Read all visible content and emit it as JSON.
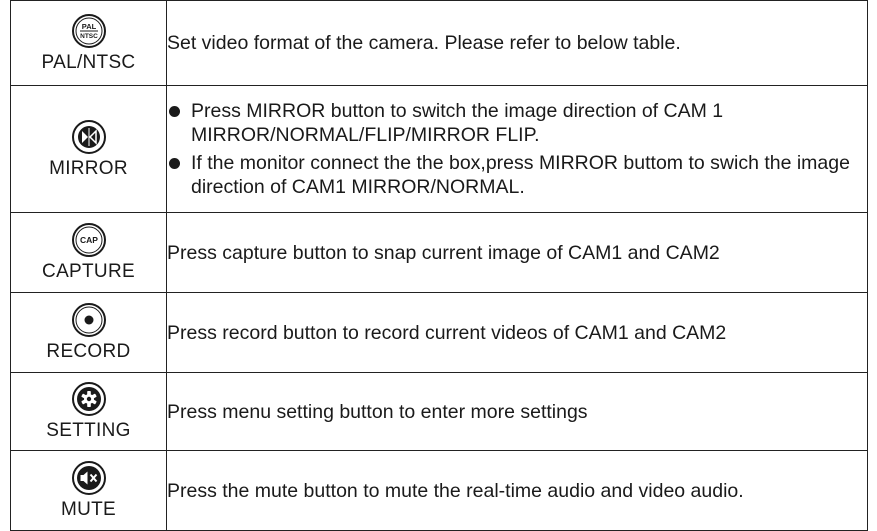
{
  "rows": [
    {
      "icon": "pal-ntsc-icon",
      "icon_text": [
        "PAL",
        "NTSC"
      ],
      "label": "PAL/NTSC",
      "description": "Set video format of the camera. Please refer to below table."
    },
    {
      "icon": "mirror-icon",
      "label": "MIRROR",
      "bullets": [
        "Press MIRROR button to switch the image direction of CAM 1 MIRROR/NORMAL/FLIP/MIRROR FLIP.",
        "If the monitor connect the the box,press MIRROR buttom to swich the image direction of CAM1  MIRROR/NORMAL."
      ]
    },
    {
      "icon": "capture-icon",
      "icon_text": "CAP",
      "label": "CAPTURE",
      "description": "Press capture button to snap current image of CAM1 and CAM2"
    },
    {
      "icon": "record-icon",
      "label": "RECORD",
      "description": "Press record button to record current videos of CAM1 and CAM2"
    },
    {
      "icon": "setting-gear-icon",
      "label": "SETTING",
      "description": "Press menu setting button to enter more settings"
    },
    {
      "icon": "mute-icon",
      "label": "MUTE",
      "description": "Press the mute button to mute the real-time audio and video audio."
    }
  ]
}
